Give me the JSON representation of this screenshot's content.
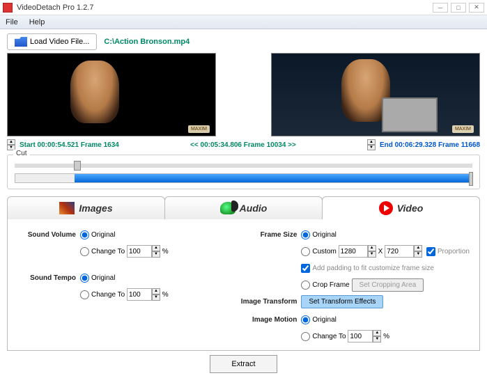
{
  "title": "VideoDetach Pro 1.2.7",
  "menu": {
    "file": "File",
    "help": "Help"
  },
  "load_btn": "Load Video File...",
  "filepath": "C:\\Action Bronson.mp4",
  "watermark": "MAXIM",
  "start_label": "Start 00:00:54.521  Frame 1634",
  "center_label": "<< 00:05:34.806  Frame 10034 >>",
  "end_label": "End 00:06:29.328  Frame 11668",
  "cut_legend": "Cut",
  "tabs": {
    "images": "Images",
    "audio": "Audio",
    "video": "Video"
  },
  "sound_volume": {
    "label": "Sound Volume",
    "original": "Original",
    "change_to": "Change To",
    "value": "100",
    "unit": "%"
  },
  "sound_tempo": {
    "label": "Sound Tempo",
    "original": "Original",
    "change_to": "Change To",
    "value": "100",
    "unit": "%"
  },
  "frame_size": {
    "label": "Frame Size",
    "original": "Original",
    "custom": "Custom",
    "w": "1280",
    "h": "720",
    "x": "X",
    "proportion": "Proportion",
    "padding": "Add padding to fit customize frame size",
    "crop": "Crop Frame",
    "crop_btn": "Set Cropping Area"
  },
  "image_transform": {
    "label": "Image Transform",
    "btn": "Set Transform Effects"
  },
  "image_motion": {
    "label": "Image Motion",
    "original": "Original",
    "change_to": "Change To",
    "value": "100",
    "unit": "%"
  },
  "extract": "Extract"
}
